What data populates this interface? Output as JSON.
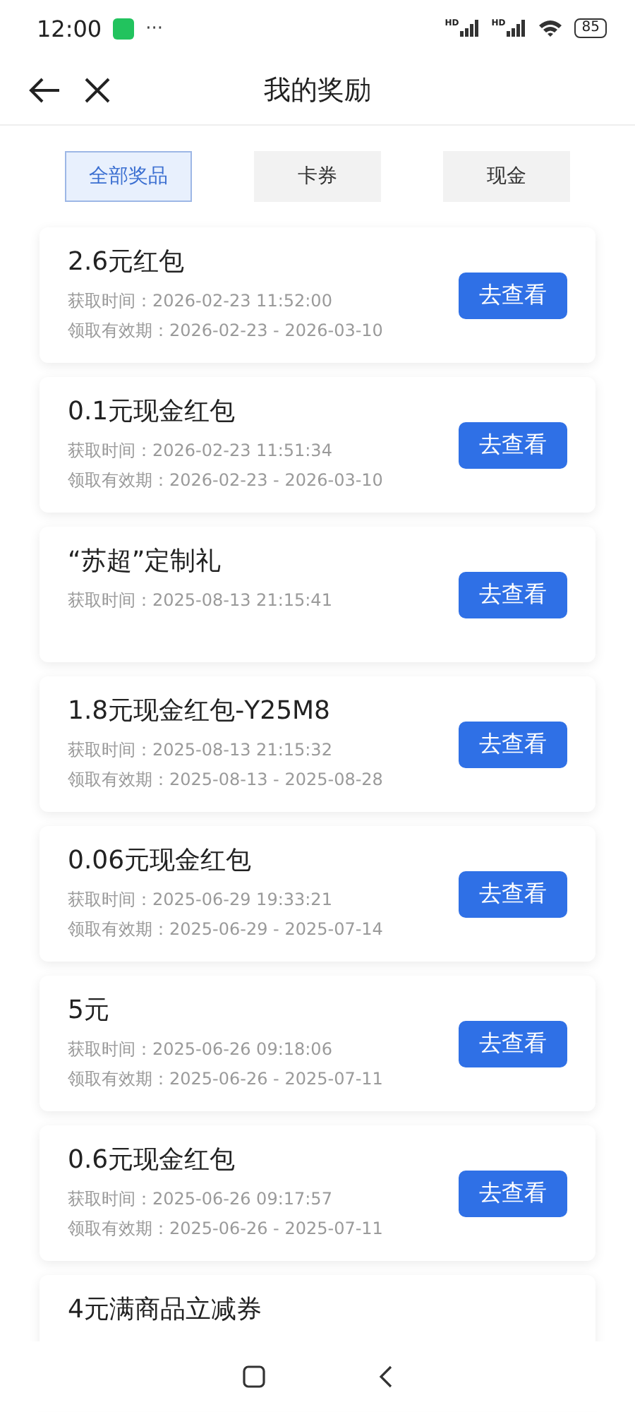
{
  "status_bar": {
    "time": "12:00",
    "more": "···",
    "signals": [
      {
        "label": "HD"
      },
      {
        "label": "HD"
      }
    ],
    "battery": "85"
  },
  "header": {
    "title": "我的奖励"
  },
  "tabs": [
    {
      "label": "全部奖品",
      "selected": true
    },
    {
      "label": "卡券",
      "selected": false
    },
    {
      "label": "现金",
      "selected": false
    }
  ],
  "rewards": [
    {
      "title": "2.6元红包",
      "lines": [
        "获取时间：2026-02-23 11:52:00",
        "领取有效期：2026-02-23 - 2026-03-10"
      ],
      "button": "去查看"
    },
    {
      "title": "0.1元现金红包",
      "lines": [
        "获取时间：2026-02-23 11:51:34",
        "领取有效期：2026-02-23 - 2026-03-10"
      ],
      "button": "去查看"
    },
    {
      "title": "“苏超”定制礼",
      "lines": [
        "获取时间：2025-08-13 21:15:41"
      ],
      "button": "去查看"
    },
    {
      "title": "1.8元现金红包-Y25M8",
      "lines": [
        "获取时间：2025-08-13 21:15:32",
        "领取有效期：2025-08-13 - 2025-08-28"
      ],
      "button": "去查看"
    },
    {
      "title": "0.06元现金红包",
      "lines": [
        "获取时间：2025-06-29 19:33:21",
        "领取有效期：2025-06-29 - 2025-07-14"
      ],
      "button": "去查看"
    },
    {
      "title": "5元",
      "lines": [
        "获取时间：2025-06-26 09:18:06",
        "领取有效期：2025-06-26 - 2025-07-11"
      ],
      "button": "去查看"
    },
    {
      "title": "0.6元现金红包",
      "lines": [
        "获取时间：2025-06-26 09:17:57",
        "领取有效期：2025-06-26 - 2025-07-11"
      ],
      "button": "去查看"
    },
    {
      "title": "4元满商品立减券"
    }
  ]
}
